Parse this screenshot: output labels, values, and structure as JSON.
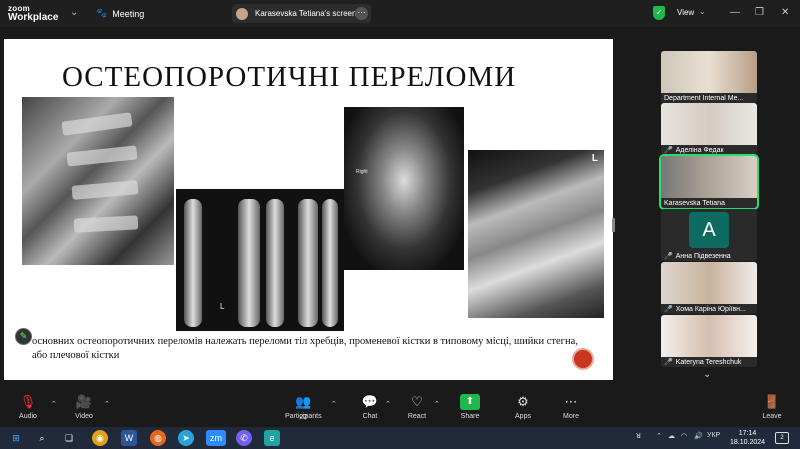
{
  "app": {
    "brand_line1": "zoom",
    "brand_line2": "Workplace"
  },
  "header": {
    "meeting_label": "Meeting",
    "screen_share_label": "Karasevska Tetiana's screen",
    "more_label": "···",
    "view_label": "View",
    "security_color": "#1fb84a"
  },
  "slide": {
    "title": "ОСТЕОПОРОТИЧНІ ПЕРЕЛОМИ",
    "caption": "основних остеопоротичних переломів належать переломи тіл хребців, променевої кістки в типовому місці, шийки стегна, або плечової кістки",
    "hip_marker": "Right",
    "wrist_marker": "L",
    "shoulder_marker": "L"
  },
  "participants": [
    {
      "name": "Department Internal Me...",
      "muted": false
    },
    {
      "name": "Аделіна Федак",
      "muted": true
    },
    {
      "name": "Karasevska Tetiana",
      "muted": false,
      "active": true
    },
    {
      "name": "Анна Підвезенна",
      "muted": true,
      "avatar_letter": "A"
    },
    {
      "name": "Хома Каріна Юріївн...",
      "muted": true
    },
    {
      "name": "Kateryna Tereshchuk",
      "muted": true
    }
  ],
  "toolbar": {
    "audio": "Audio",
    "video": "Video",
    "participants": "Participants",
    "participants_count": "22",
    "chat": "Chat",
    "react": "React",
    "share": "Share",
    "apps": "Apps",
    "more": "More",
    "leave": "Leave"
  },
  "taskbar": {
    "language": "УКР",
    "time": "17:14",
    "date": "18.10.2024",
    "notifications": "2"
  }
}
